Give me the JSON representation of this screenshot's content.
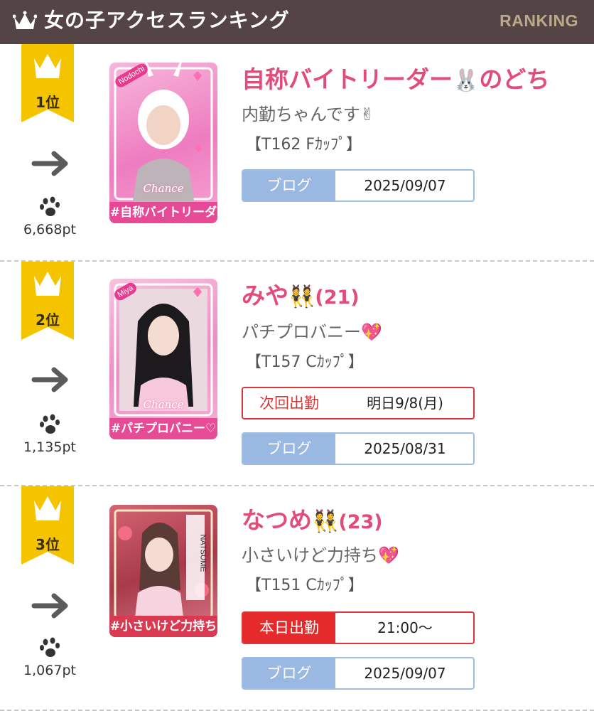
{
  "header": {
    "title": "女の子アクセスランキング",
    "ranking_label": "RANKING",
    "crown_icon": "crown-icon"
  },
  "colors": {
    "header_bg": "#554446",
    "ribbon_gold": "#f5c400",
    "name_pink": "#e34b79",
    "blog_blue": "#9ab9e2",
    "red": "#e42a2a"
  },
  "entries": [
    {
      "rank": "1位",
      "trend_icon": "arrow-right-icon",
      "points": "6,668pt",
      "photo": {
        "nick": "Nodochi",
        "brand": "Chance",
        "tag": "#自称バイトリーダー",
        "bg": "#f49ad0"
      },
      "name": "自称バイトリーダー",
      "name_emoji": "🐰",
      "name_after": "のどち",
      "catch": "内勤ちゃんです✌",
      "spec": "【T162 Fｶｯﾌﾟ】",
      "schedule": null,
      "blog_label": "ブログ",
      "blog_date": "2025/09/07"
    },
    {
      "rank": "2位",
      "trend_icon": "arrow-right-icon",
      "points": "1,135pt",
      "photo": {
        "nick": "Miya",
        "brand": "Chance",
        "tag": "#パチプロバニー♡",
        "bg": "#f19ac6"
      },
      "name": "みや",
      "name_emoji": "👯",
      "age": "(21)",
      "catch": "パチプロバニー💖",
      "spec": "【T157 Cｶｯﾌﾟ】",
      "schedule": {
        "label": "次回出勤",
        "value": "明日9/8(月)",
        "style": "next"
      },
      "blog_label": "ブログ",
      "blog_date": "2025/08/31"
    },
    {
      "rank": "3位",
      "trend_icon": "arrow-right-icon",
      "points": "1,067pt",
      "photo": {
        "nick": "NATSUME",
        "brand": "",
        "tag": "#小さいけど力持ち",
        "bg": "#c44a5a"
      },
      "name": "なつめ",
      "name_emoji": "👯",
      "age": "(23)",
      "catch": "小さいけど力持ち💖",
      "spec": "【T151 Cｶｯﾌﾟ】",
      "schedule": {
        "label": "本日出勤",
        "value": "21:00〜",
        "style": "today"
      },
      "blog_label": "ブログ",
      "blog_date": "2025/09/07"
    }
  ]
}
